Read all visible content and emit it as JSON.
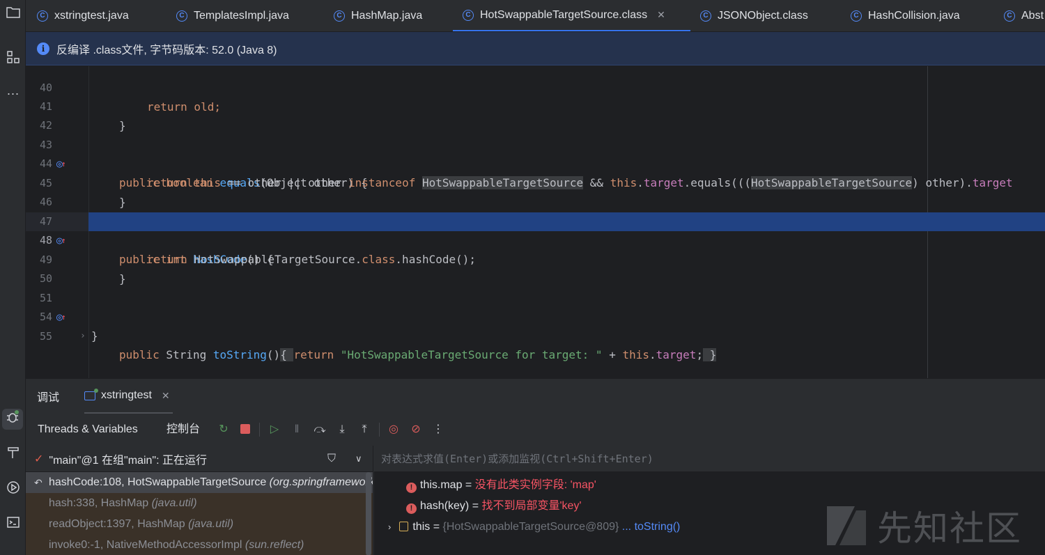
{
  "tabs": [
    {
      "label": "xstringtest.java",
      "active": false
    },
    {
      "label": "TemplatesImpl.java",
      "active": false
    },
    {
      "label": "HashMap.java",
      "active": false
    },
    {
      "label": "HotSwappableTargetSource.class",
      "active": true
    },
    {
      "label": "JSONObject.class",
      "active": false
    },
    {
      "label": "HashCollision.java",
      "active": false
    },
    {
      "label": "Abst",
      "active": false
    }
  ],
  "banner": {
    "text": "反编译 .class文件, 字节码版本: 52.0 (Java 8)",
    "icon": "info-icon"
  },
  "editor": {
    "line_numbers": [
      "40",
      "41",
      "42",
      "43",
      "44",
      "45",
      "46",
      "47",
      "48",
      "49",
      "50",
      "51",
      "54",
      "55"
    ],
    "current_line": "48",
    "code": {
      "l40": "return old;",
      "l41": "}",
      "l43": {
        "kw1": "public boolean ",
        "fn": "equals",
        "rest": "(Object other) {"
      },
      "l44": {
        "kw1": "return this",
        "p1": " == other || other ",
        "kw2": "instanceof",
        "p2": " ",
        "ref1": "HotSwappableTargetSource",
        "p3": " && ",
        "kw3": "this",
        "p4": ".",
        "f1": "target",
        "p5": ".equals(((",
        "ref2": "HotSwappableTargetSource",
        "p6": ") other).",
        "f2": "target"
      },
      "l45": "}",
      "l47": {
        "kw1": "public int ",
        "fn": "hashCode",
        "rest": "() {"
      },
      "l48": {
        "kw1": "return",
        "p1": " HotSwappableTargetSource.",
        "kw2": "class",
        "p2": ".hashCode();"
      },
      "l49": "}",
      "l51": {
        "kw1": "public",
        "p1": " String ",
        "fn": "toString",
        "p2": "()",
        "b1": "{ ",
        "kw2": "return",
        "str": " \"HotSwappableTargetSource for target: \"",
        "p3": " + ",
        "kw3": "this",
        "p4": ".",
        "f1": "target",
        "p5": ";",
        "b2": " }"
      },
      "l54": "}"
    }
  },
  "debug": {
    "tabs": [
      {
        "label": "调试"
      },
      {
        "label": "xstringtest"
      }
    ],
    "toolbar": {
      "threads_label": "Threads & Variables",
      "console_label": "控制台"
    },
    "thread_status": "\"main\"@1 在组\"main\": 正在运行",
    "frames": [
      {
        "method": "hashCode:108, HotSwappableTargetSource ",
        "pkg": "(org.springframework.aop.target)"
      },
      {
        "method": "hash:338, HashMap ",
        "pkg": "(java.util)"
      },
      {
        "method": "readObject:1397, HashMap ",
        "pkg": "(java.util)"
      },
      {
        "method": "invoke0:-1, NativeMethodAccessorImpl ",
        "pkg": "(sun.reflect)"
      }
    ],
    "eval_placeholder": "对表达式求值(Enter)或添加监视(Ctrl+Shift+Enter)",
    "variables": [
      {
        "name": "this.map",
        "eq": " = ",
        "value": "没有此类实例字段: 'map'"
      },
      {
        "name": "hash(key)",
        "eq": " = ",
        "value": "找不到局部变量'key'"
      },
      {
        "name": "this",
        "eq": " = ",
        "value": "{HotSwappableTargetSource@809}",
        "link": " ... toString()"
      }
    ]
  },
  "watermark": "先知社区",
  "colors": {
    "accent": "#3574f0",
    "selection": "#214283",
    "keyword": "#cf8e6d",
    "function": "#56a8f5",
    "field": "#c77dbb",
    "string": "#6aab73",
    "error": "#f75464"
  }
}
